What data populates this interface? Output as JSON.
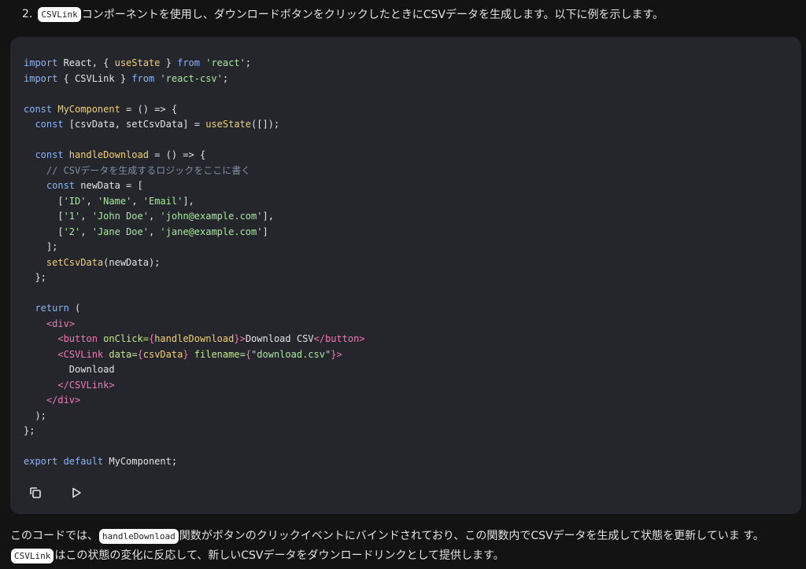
{
  "intro": {
    "number": "2.",
    "code_term": "CSVLink",
    "text": "コンポーネントを使用し、ダウンロードボタンをクリックしたときにCSVデータを生成します。以下に例を示します。"
  },
  "code": {
    "lines": [
      [
        [
          "kw",
          "import"
        ],
        [
          "var",
          " React, { "
        ],
        [
          "fn",
          "useState"
        ],
        [
          "var",
          " } "
        ],
        [
          "kw",
          "from"
        ],
        [
          "str",
          " 'react'"
        ],
        [
          "var",
          ";"
        ]
      ],
      [
        [
          "kw",
          "import"
        ],
        [
          "var",
          " { CSVLink } "
        ],
        [
          "kw",
          "from"
        ],
        [
          "str",
          " 'react-csv'"
        ],
        [
          "var",
          ";"
        ]
      ],
      [],
      [
        [
          "kw",
          "const"
        ],
        [
          "fn",
          " MyComponent"
        ],
        [
          "var",
          " = () => {"
        ]
      ],
      [
        [
          "var",
          "  "
        ],
        [
          "kw",
          "const"
        ],
        [
          "var",
          " [csvData, setCsvData] = "
        ],
        [
          "fn",
          "useState"
        ],
        [
          "var",
          "([]);"
        ]
      ],
      [],
      [
        [
          "var",
          "  "
        ],
        [
          "kw",
          "const"
        ],
        [
          "fn",
          " handleDownload"
        ],
        [
          "var",
          " = () => {"
        ]
      ],
      [
        [
          "cm",
          "    // CSVデータを生成するロジックをここに書く"
        ]
      ],
      [
        [
          "var",
          "    "
        ],
        [
          "kw",
          "const"
        ],
        [
          "var",
          " newData = ["
        ]
      ],
      [
        [
          "var",
          "      ["
        ],
        [
          "str",
          "'ID'"
        ],
        [
          "var",
          ", "
        ],
        [
          "str",
          "'Name'"
        ],
        [
          "var",
          ", "
        ],
        [
          "str",
          "'Email'"
        ],
        [
          "var",
          "],"
        ]
      ],
      [
        [
          "var",
          "      ["
        ],
        [
          "str",
          "'1'"
        ],
        [
          "var",
          ", "
        ],
        [
          "str",
          "'John Doe'"
        ],
        [
          "var",
          ", "
        ],
        [
          "str",
          "'john@example.com'"
        ],
        [
          "var",
          "],"
        ]
      ],
      [
        [
          "var",
          "      ["
        ],
        [
          "str",
          "'2'"
        ],
        [
          "var",
          ", "
        ],
        [
          "str",
          "'Jane Doe'"
        ],
        [
          "var",
          ", "
        ],
        [
          "str",
          "'jane@example.com'"
        ],
        [
          "var",
          "]"
        ]
      ],
      [
        [
          "var",
          "    ];"
        ]
      ],
      [
        [
          "var",
          "    "
        ],
        [
          "fn",
          "setCsvData"
        ],
        [
          "var",
          "(newData);"
        ]
      ],
      [
        [
          "var",
          "  };"
        ]
      ],
      [],
      [
        [
          "var",
          "  "
        ],
        [
          "kw",
          "return"
        ],
        [
          "var",
          " ("
        ]
      ],
      [
        [
          "var",
          "    "
        ],
        [
          "tag",
          "<div>"
        ]
      ],
      [
        [
          "var",
          "      "
        ],
        [
          "tag",
          "<button"
        ],
        [
          "attr",
          " onClick="
        ],
        [
          "tag",
          "{"
        ],
        [
          "fn",
          "handleDownload"
        ],
        [
          "tag",
          "}"
        ],
        [
          "tag",
          ">"
        ],
        [
          "var",
          "Download CSV"
        ],
        [
          "tag",
          "</button>"
        ]
      ],
      [
        [
          "var",
          "      "
        ],
        [
          "tag",
          "<CSVLink"
        ],
        [
          "attr",
          " data="
        ],
        [
          "tag",
          "{"
        ],
        [
          "fn",
          "csvData"
        ],
        [
          "tag",
          "}"
        ],
        [
          "attr",
          " filename="
        ],
        [
          "tag",
          "{"
        ],
        [
          "str",
          "\"download.csv\""
        ],
        [
          "tag",
          "}"
        ],
        [
          "tag",
          ">"
        ]
      ],
      [
        [
          "var",
          "        Download"
        ]
      ],
      [
        [
          "var",
          "      "
        ],
        [
          "tag",
          "</CSVLink>"
        ]
      ],
      [
        [
          "var",
          "    "
        ],
        [
          "tag",
          "</div>"
        ]
      ],
      [
        [
          "var",
          "  );"
        ]
      ],
      [
        [
          "var",
          "};"
        ]
      ],
      [],
      [
        [
          "kw",
          "export default"
        ],
        [
          "var",
          " MyComponent;"
        ]
      ]
    ],
    "actions": {
      "copy_icon": "copy-icon",
      "run_icon": "play-icon"
    }
  },
  "paragraph": {
    "part1": "このコードでは、",
    "code1": "handleDownload",
    "part2": "関数がボタンのクリックイベントにバインドされており、この関数内でCSVデータを生成して状態を更新していま す。",
    "code2": "CSVLink",
    "part3": "はこの状態の変化に反応して、新しいCSVデータをダウンロードリンクとして提供します。"
  },
  "colors": {
    "background": "#131314",
    "code_background": "#25262b",
    "keyword": "#8ab4f8",
    "string": "#a8e6a1",
    "function": "#f0d077",
    "tag": "#f178b6",
    "comment": "#7f8ea3"
  }
}
